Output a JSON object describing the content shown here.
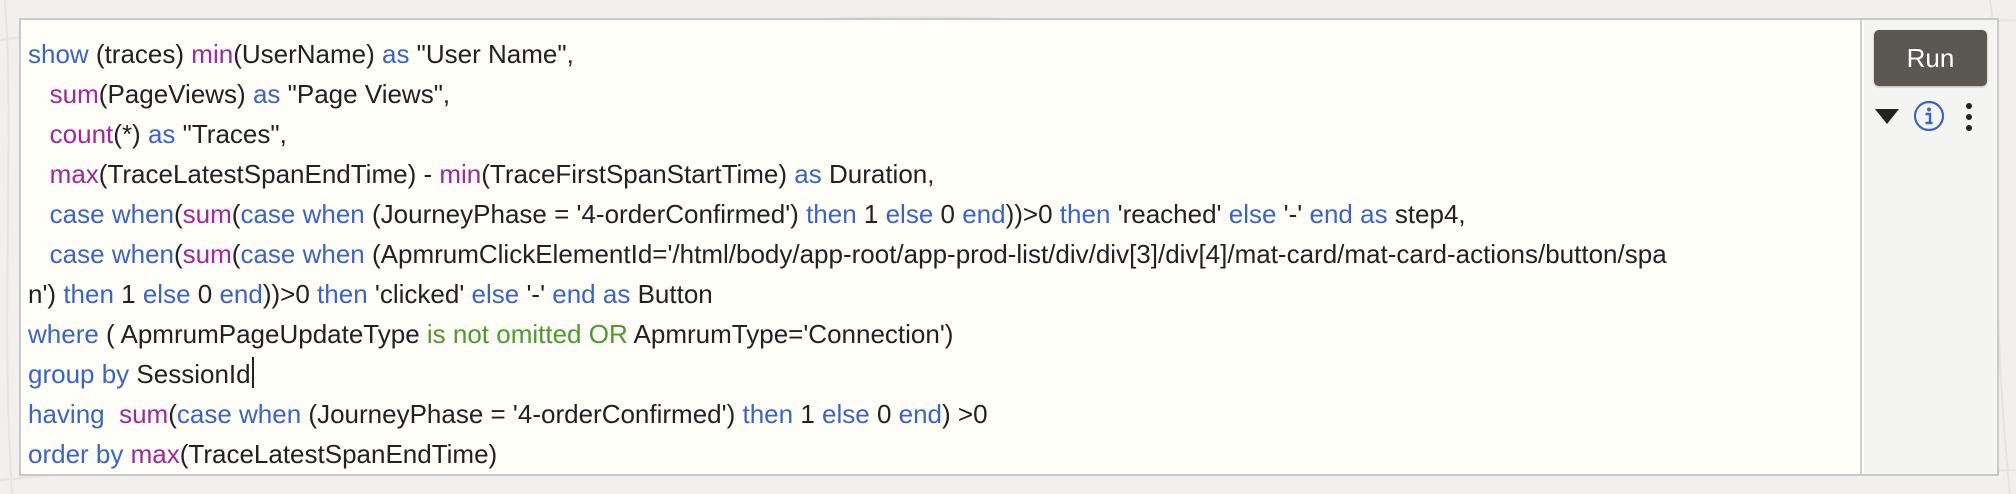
{
  "query": {
    "lines": [
      [
        {
          "t": "show",
          "c": "kw"
        },
        {
          "t": " (traces) "
        },
        {
          "t": "min",
          "c": "fn"
        },
        {
          "t": "(UserName) "
        },
        {
          "t": "as",
          "c": "kw"
        },
        {
          "t": " \"User Name\","
        }
      ],
      [
        {
          "t": "   "
        },
        {
          "t": "sum",
          "c": "fn"
        },
        {
          "t": "(PageViews) "
        },
        {
          "t": "as",
          "c": "kw"
        },
        {
          "t": " \"Page Views\","
        }
      ],
      [
        {
          "t": "   "
        },
        {
          "t": "count",
          "c": "fn"
        },
        {
          "t": "(*) "
        },
        {
          "t": "as",
          "c": "kw"
        },
        {
          "t": " \"Traces\","
        }
      ],
      [
        {
          "t": "   "
        },
        {
          "t": "max",
          "c": "fn"
        },
        {
          "t": "(TraceLatestSpanEndTime) - "
        },
        {
          "t": "min",
          "c": "fn"
        },
        {
          "t": "(TraceFirstSpanStartTime) "
        },
        {
          "t": "as",
          "c": "kw"
        },
        {
          "t": " Duration,"
        }
      ],
      [
        {
          "t": "   "
        },
        {
          "t": "case",
          "c": "kw"
        },
        {
          "t": " "
        },
        {
          "t": "when",
          "c": "kw"
        },
        {
          "t": "("
        },
        {
          "t": "sum",
          "c": "fn"
        },
        {
          "t": "("
        },
        {
          "t": "case",
          "c": "kw"
        },
        {
          "t": " "
        },
        {
          "t": "when",
          "c": "kw"
        },
        {
          "t": " (JourneyPhase = '4-orderConfirmed') "
        },
        {
          "t": "then",
          "c": "kw"
        },
        {
          "t": " 1 "
        },
        {
          "t": "else",
          "c": "kw"
        },
        {
          "t": " 0 "
        },
        {
          "t": "end",
          "c": "kw"
        },
        {
          "t": "))>0 "
        },
        {
          "t": "then",
          "c": "kw"
        },
        {
          "t": " 'reached' "
        },
        {
          "t": "else",
          "c": "kw"
        },
        {
          "t": " '-' "
        },
        {
          "t": "end",
          "c": "kw"
        },
        {
          "t": " "
        },
        {
          "t": "as",
          "c": "kw"
        },
        {
          "t": " step4,"
        }
      ],
      [
        {
          "t": "   "
        },
        {
          "t": "case",
          "c": "kw"
        },
        {
          "t": " "
        },
        {
          "t": "when",
          "c": "kw"
        },
        {
          "t": "("
        },
        {
          "t": "sum",
          "c": "fn"
        },
        {
          "t": "("
        },
        {
          "t": "case",
          "c": "kw"
        },
        {
          "t": " "
        },
        {
          "t": "when",
          "c": "kw"
        },
        {
          "t": " (ApmrumClickElementId='/html/body/app-root/app-prod-list/div/div[3]/div[4]/mat-card/mat-card-actions/button/spa"
        }
      ],
      [
        {
          "t": "n') "
        },
        {
          "t": "then",
          "c": "kw"
        },
        {
          "t": " 1 "
        },
        {
          "t": "else",
          "c": "kw"
        },
        {
          "t": " 0 "
        },
        {
          "t": "end",
          "c": "kw"
        },
        {
          "t": "))>0 "
        },
        {
          "t": "then",
          "c": "kw"
        },
        {
          "t": " 'clicked' "
        },
        {
          "t": "else",
          "c": "kw"
        },
        {
          "t": " '-' "
        },
        {
          "t": "end",
          "c": "kw"
        },
        {
          "t": " "
        },
        {
          "t": "as",
          "c": "kw"
        },
        {
          "t": " Button"
        }
      ],
      [
        {
          "t": "where",
          "c": "kw"
        },
        {
          "t": " ( ApmrumPageUpdateType "
        },
        {
          "t": "is not omitted",
          "c": "grn"
        },
        {
          "t": " "
        },
        {
          "t": "OR",
          "c": "grn"
        },
        {
          "t": " ApmrumType='Connection')"
        }
      ],
      [
        {
          "t": "group by",
          "c": "kw"
        },
        {
          "t": " SessionId"
        },
        {
          "caret": true
        }
      ],
      [
        {
          "t": "having",
          "c": "kw"
        },
        {
          "t": "  "
        },
        {
          "t": "sum",
          "c": "fn"
        },
        {
          "t": "("
        },
        {
          "t": "case",
          "c": "kw"
        },
        {
          "t": " "
        },
        {
          "t": "when",
          "c": "kw"
        },
        {
          "t": " (JourneyPhase = '4-orderConfirmed') "
        },
        {
          "t": "then",
          "c": "kw"
        },
        {
          "t": " 1 "
        },
        {
          "t": "else",
          "c": "kw"
        },
        {
          "t": " 0 "
        },
        {
          "t": "end",
          "c": "kw"
        },
        {
          "t": ") >0"
        }
      ],
      [
        {
          "t": "order by",
          "c": "kw"
        },
        {
          "t": " "
        },
        {
          "t": "max",
          "c": "fn"
        },
        {
          "t": "(TraceLatestSpanEndTime)"
        }
      ]
    ]
  },
  "toolbar": {
    "run_label": "Run",
    "icons": [
      "caret-down-icon",
      "info-icon",
      "more-vertical-icon"
    ]
  },
  "colors": {
    "keyword": "#3a64c8",
    "function": "#a127a0",
    "operator": "#4c9a2a",
    "run_button": "#5b5752"
  }
}
